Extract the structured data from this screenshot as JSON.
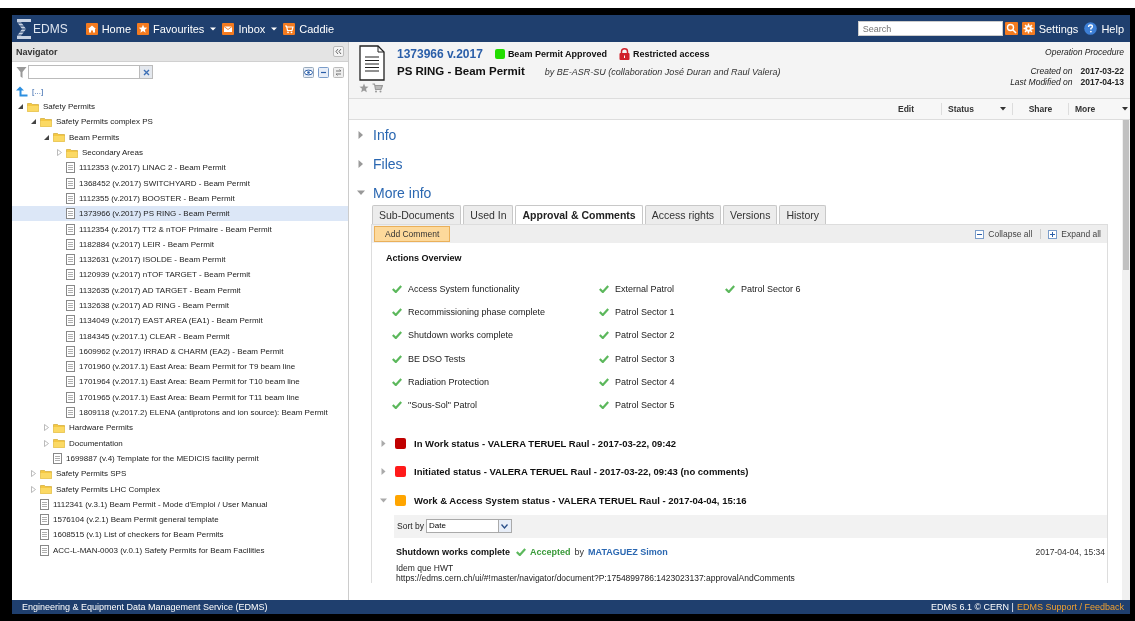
{
  "topbar": {
    "logo": "EDMS",
    "nav": [
      {
        "label": "Home",
        "dropdown": false
      },
      {
        "label": "Favourites",
        "dropdown": true
      },
      {
        "label": "Inbox",
        "dropdown": true
      },
      {
        "label": "Caddie",
        "dropdown": false
      }
    ],
    "search": {
      "placeholder": "Search"
    },
    "settings": "Settings",
    "help": "Help"
  },
  "navigator": {
    "title": "Navigator",
    "up": "[...]",
    "tree": [
      {
        "label": "Safety Permits",
        "kind": "folder",
        "expanded": true,
        "selected": false,
        "children": [
          {
            "label": "Safety Permits complex PS",
            "kind": "folder",
            "expanded": true,
            "selected": false,
            "children": [
              {
                "label": "Beam Permits",
                "kind": "folder",
                "expanded": true,
                "selected": false,
                "children": [
                  {
                    "label": "Secondary Areas",
                    "kind": "folder",
                    "expanded": false,
                    "selected": false
                  },
                  {
                    "label": "1112353 (v.2017) LINAC 2 - Beam Permit",
                    "kind": "document",
                    "selected": false
                  },
                  {
                    "label": "1368452 (v.2017) SWITCHYARD - Beam Permit",
                    "kind": "document",
                    "selected": false
                  },
                  {
                    "label": "1112355 (v.2017) BOOSTER - Beam Permit",
                    "kind": "document",
                    "selected": false
                  },
                  {
                    "label": "1373966 (v.2017) PS RING - Beam Permit",
                    "kind": "document",
                    "selected": true
                  },
                  {
                    "label": "1112354 (v.2017) TT2 & nTOF Primaire - Beam Permit",
                    "kind": "document",
                    "selected": false
                  },
                  {
                    "label": "1182884 (v.2017) LEIR - Beam Permit",
                    "kind": "document",
                    "selected": false
                  },
                  {
                    "label": "1132631 (v.2017) ISOLDE - Beam Permit",
                    "kind": "document",
                    "selected": false
                  },
                  {
                    "label": "1120939 (v.2017) nTOF TARGET - Beam Permit",
                    "kind": "document",
                    "selected": false
                  },
                  {
                    "label": "1132635 (v.2017) AD TARGET - Beam Permit",
                    "kind": "document",
                    "selected": false
                  },
                  {
                    "label": "1132638 (v.2017) AD RING - Beam Permit",
                    "kind": "document",
                    "selected": false
                  },
                  {
                    "label": "1134049 (v.2017) EAST AREA (EA1) - Beam Permit",
                    "kind": "document",
                    "selected": false
                  },
                  {
                    "label": "1184345 (v.2017.1) CLEAR - Beam Permit",
                    "kind": "document",
                    "selected": false
                  },
                  {
                    "label": "1609962 (v.2017) IRRAD & CHARM (EA2) - Beam Permit",
                    "kind": "document",
                    "selected": false
                  },
                  {
                    "label": "1701960 (v.2017.1) East Area: Beam Permit for T9 beam line",
                    "kind": "document",
                    "selected": false
                  },
                  {
                    "label": "1701964 (v.2017.1) East Area: Beam Permit for T10 beam line",
                    "kind": "document",
                    "selected": false
                  },
                  {
                    "label": "1701965 (v.2017.1) East Area: Beam Permit for T11 beam line",
                    "kind": "document",
                    "selected": false
                  },
                  {
                    "label": "1809118 (v.2017.2) ELENA (antiprotons and ion source): Beam Permit",
                    "kind": "document",
                    "selected": false
                  }
                ]
              },
              {
                "label": "Hardware Permits",
                "kind": "folder",
                "expanded": false,
                "selected": false
              },
              {
                "label": "Documentation",
                "kind": "folder",
                "expanded": false,
                "selected": false
              },
              {
                "label": "1699887 (v.4) Template for the MEDICIS facility permit",
                "kind": "document",
                "selected": false
              }
            ]
          },
          {
            "label": "Safety Permits SPS",
            "kind": "folder",
            "expanded": false,
            "selected": false
          },
          {
            "label": "Safety Permits LHC Complex",
            "kind": "folder",
            "expanded": false,
            "selected": false
          },
          {
            "label": "1112341 (v.3.1) Beam Permit - Mode d'Emploi / User Manual",
            "kind": "document",
            "selected": false
          },
          {
            "label": "1576104 (v.2.1) Beam Permit general template",
            "kind": "document",
            "selected": false
          },
          {
            "label": "1608515 (v.1) List of checkers for Beam Permits",
            "kind": "document",
            "selected": false
          },
          {
            "label": "ACC-L-MAN-0003 (v.0.1) Safety Permits for Beam Facilities",
            "kind": "document",
            "selected": false
          }
        ]
      }
    ]
  },
  "document": {
    "number": "1373966 v.2017",
    "status": {
      "label": "Beam Permit Approved",
      "color": "#22dd00"
    },
    "access": "Restricted access",
    "title": "PS RING - Beam Permit",
    "author": "by BE-ASR-SU (collaboration José Duran and Raul Valera)",
    "type": "Operation Procedure",
    "created_label": "Created on",
    "created": "2017-03-22",
    "modified_label": "Last Modified on",
    "modified": "2017-04-13"
  },
  "toolbar": [
    {
      "label": "Edit",
      "dropdown": false
    },
    {
      "label": "Status",
      "dropdown": true
    },
    {
      "label": "Share",
      "dropdown": false
    },
    {
      "label": "More",
      "dropdown": true
    }
  ],
  "sections": [
    {
      "label": "Info",
      "expanded": false
    },
    {
      "label": "Files",
      "expanded": false
    },
    {
      "label": "More info",
      "expanded": true
    }
  ],
  "tabs": [
    {
      "label": "Sub-Documents",
      "selected": false
    },
    {
      "label": "Used In",
      "selected": false
    },
    {
      "label": "Approval & Comments",
      "selected": true
    },
    {
      "label": "Access rights",
      "selected": false
    },
    {
      "label": "Versions",
      "selected": false
    },
    {
      "label": "History",
      "selected": false
    }
  ],
  "panel": {
    "add_comment": "Add Comment",
    "collapse_all": "Collapse all",
    "expand_all": "Expand all",
    "actions_title": "Actions Overview",
    "actions": [
      [
        {
          "label": "Access System functionality",
          "done": true
        },
        {
          "label": "Recommissioning phase complete",
          "done": true
        },
        {
          "label": "Shutdown works complete",
          "done": true
        },
        {
          "label": "BE DSO Tests",
          "done": true
        },
        {
          "label": "Radiation Protection",
          "done": true
        },
        {
          "label": "\"Sous-Sol\" Patrol",
          "done": true
        }
      ],
      [
        {
          "label": "External Patrol",
          "done": true
        },
        {
          "label": "Patrol Sector 1",
          "done": true
        },
        {
          "label": "Patrol Sector 2",
          "done": true
        },
        {
          "label": "Patrol Sector 3",
          "done": true
        },
        {
          "label": "Patrol Sector 4",
          "done": true
        },
        {
          "label": "Patrol Sector 5",
          "done": true
        }
      ],
      [
        {
          "label": "Patrol Sector 6",
          "done": true
        }
      ]
    ],
    "statuses": [
      {
        "label": "In Work status - VALERA TERUEL Raul - 2017-03-22, 09:42",
        "color": "#c00000",
        "expanded": false
      },
      {
        "label": "Initiated status - VALERA TERUEL Raul - 2017-03-22, 09:43 (no comments)",
        "color": "#ff1a1a",
        "expanded": false
      },
      {
        "label": "Work & Access System status - VALERA TERUEL Raul - 2017-04-04, 15:16",
        "color": "#ffa500",
        "expanded": true,
        "sort_label": "Sort by",
        "sort_value": "Date",
        "comment": {
          "action": "Shutdown works complete",
          "result": "Accepted",
          "by": "by",
          "author": "MATAGUEZ Simon",
          "date": "2017-04-04, 15:34",
          "lines": [
            "Idem que HWT",
            "https://edms.cern.ch/ui/#!master/navigator/document?P:1754899786:1423023137:approvalAndComments"
          ]
        }
      }
    ]
  },
  "footer": {
    "left": "Engineering & Equipment Data Management Service (EDMS)",
    "right": "EDMS 6.1 © CERN |",
    "link": "EDMS Support / Feedback"
  }
}
